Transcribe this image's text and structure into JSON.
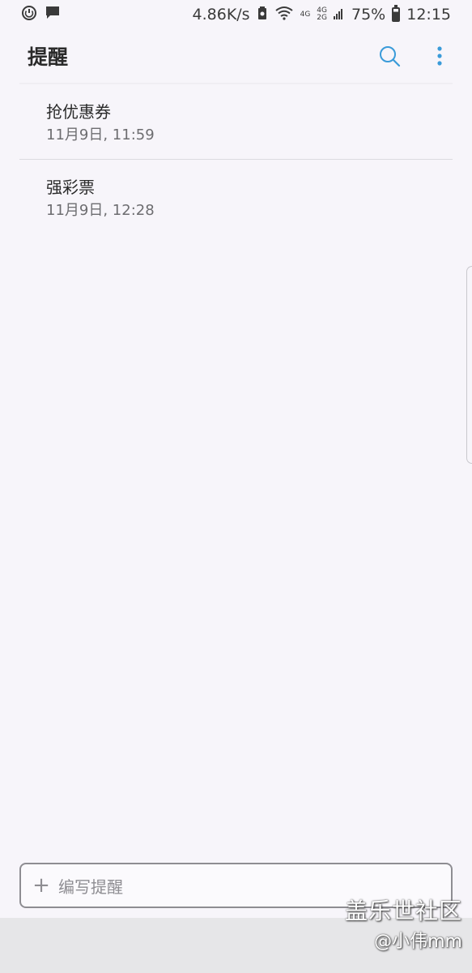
{
  "status_bar": {
    "speed": "4.86K/s",
    "net_top": "4G",
    "net_bottom_top": "4G",
    "net_bottom_bottom": "2G",
    "battery": "75%",
    "time": "12:15"
  },
  "appbar": {
    "title": "提醒"
  },
  "reminders": [
    {
      "title": "抢优惠券",
      "time": "11月9日, 11:59"
    },
    {
      "title": "强彩票",
      "time": "11月9日, 12:28"
    }
  ],
  "compose": {
    "placeholder": "编写提醒"
  },
  "watermark": {
    "line1": "盖乐世社区",
    "line2": "@小伟mm"
  },
  "colors": {
    "accent": "#3a9bd9",
    "background": "#f7f5fa"
  }
}
